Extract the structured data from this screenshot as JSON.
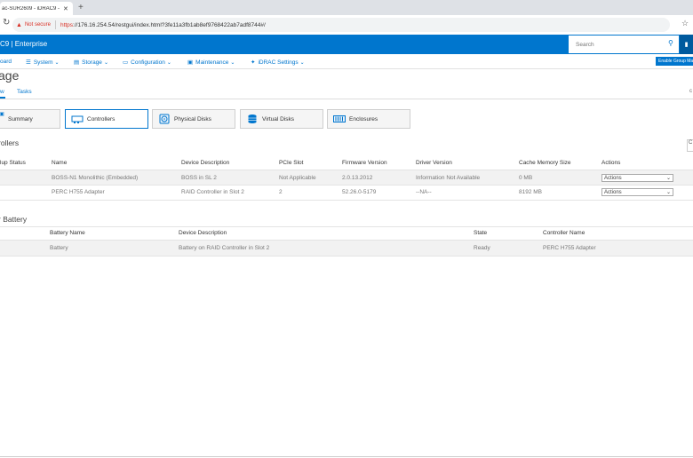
{
  "browser": {
    "tab_title": "ac-SUR2609 - iDRAC9 - Stora",
    "tab_close": "✕",
    "new_tab": "+",
    "not_secure": "Not secure",
    "url_https": "https",
    "url_rest": "://176.16.254.54/restgui/index.html?3fe11a3fb1ab8ef9768422ab7adf8744#/"
  },
  "header": {
    "brand": "C9 | Enterprise",
    "search_placeholder": "Search"
  },
  "nav": {
    "items": [
      {
        "label": "oard"
      },
      {
        "label": "System"
      },
      {
        "label": "Storage"
      },
      {
        "label": "Configuration"
      },
      {
        "label": "Maintenance"
      },
      {
        "label": "iDRAC Settings"
      }
    ],
    "enable_group_manager": "Enable Group Man"
  },
  "page": {
    "title": "age",
    "tabs": [
      "w",
      "Tasks"
    ],
    "right_edge_c": "c"
  },
  "cards": [
    {
      "label": "Summary",
      "icon": "summary-icon"
    },
    {
      "label": "Controllers",
      "icon": "controller-icon"
    },
    {
      "label": "Physical Disks",
      "icon": "physical-disk-icon"
    },
    {
      "label": "Virtual Disks",
      "icon": "virtual-disk-icon"
    },
    {
      "label": "Enclosures",
      "icon": "enclosure-icon"
    }
  ],
  "controllers": {
    "heading": "rollers",
    "right_button": "C",
    "columns": [
      "lup Status",
      "Name",
      "Device Description",
      "PCIe Slot",
      "Firmware Version",
      "Driver Version",
      "Cache Memory Size",
      "Actions"
    ],
    "rows": [
      {
        "name": "BOSS-N1 Monolithic (Embedded)",
        "desc": "BOSS in SL 2",
        "pcie": "Not Applicable",
        "fw": "2.0.13.2012",
        "driver": "Information Not Available",
        "cache": "0 MB",
        "action": "Actions"
      },
      {
        "name": "PERC H755 Adapter",
        "desc": "RAID Controller in Slot 2",
        "pcie": "2",
        "fw": "52.26.0-5179",
        "driver": "--NA--",
        "cache": "8192 MB",
        "action": "Actions"
      }
    ]
  },
  "battery": {
    "heading": "r Battery",
    "columns": [
      "Battery Name",
      "Device Description",
      "State",
      "Controller Name"
    ],
    "rows": [
      {
        "name": "Battery",
        "desc": "Battery on RAID Controller in Slot 2",
        "state": "Ready",
        "controller": "PERC H755 Adapter"
      }
    ]
  },
  "colors": {
    "accent": "#0076ce",
    "not_secure": "#d93025"
  }
}
